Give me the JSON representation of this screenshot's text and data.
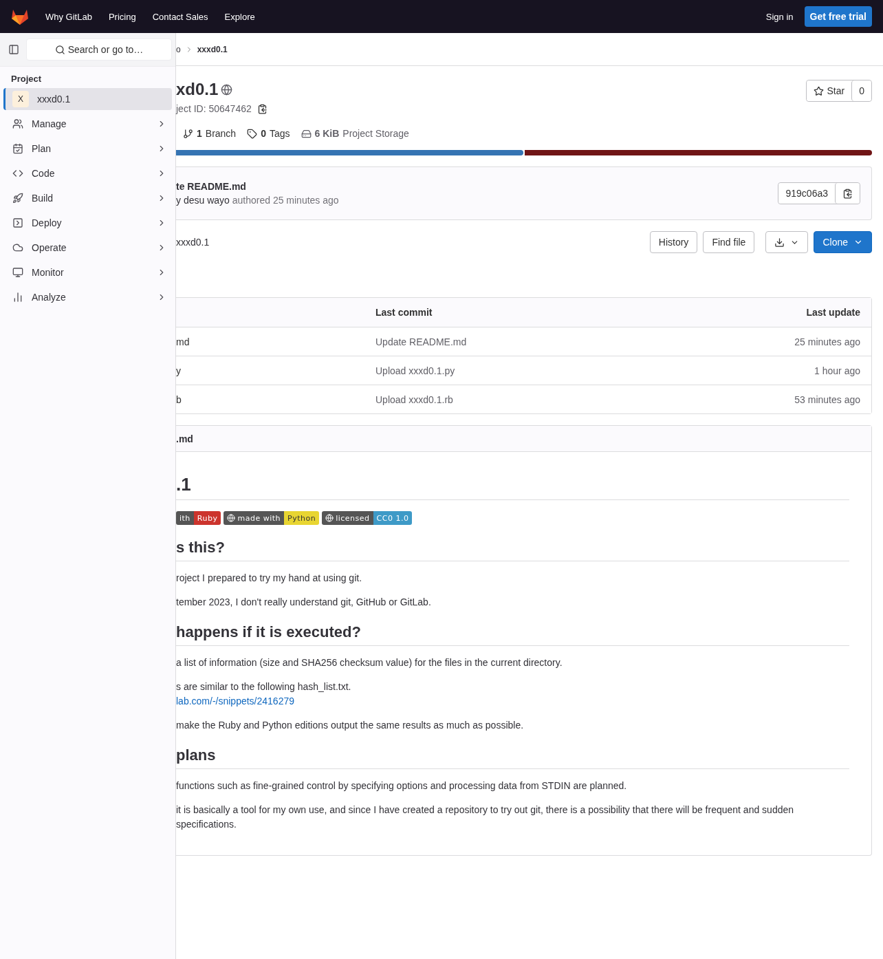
{
  "topnav": {
    "links": [
      "Why GitLab",
      "Pricing",
      "Contact Sales",
      "Explore"
    ],
    "sign_in": "Sign in",
    "trial": "Get free trial"
  },
  "sidebar": {
    "search_placeholder": "Search or go to…",
    "section": "Project",
    "items": [
      {
        "label": "xxxd0.1",
        "avatar": "X",
        "selected": true,
        "kind": "project"
      },
      {
        "label": "Manage",
        "selected": false,
        "kind": "menu"
      },
      {
        "label": "Plan",
        "selected": false,
        "kind": "menu"
      },
      {
        "label": "Code",
        "selected": false,
        "kind": "menu"
      },
      {
        "label": "Build",
        "selected": false,
        "kind": "menu"
      },
      {
        "label": "Deploy",
        "selected": false,
        "kind": "menu"
      },
      {
        "label": "Operate",
        "selected": false,
        "kind": "menu"
      },
      {
        "label": "Monitor",
        "selected": false,
        "kind": "menu"
      },
      {
        "label": "Analyze",
        "selected": false,
        "kind": "menu"
      }
    ]
  },
  "breadcrumb": [
    "o",
    "xxxd0.1"
  ],
  "project": {
    "title": "xd0.1",
    "id_text": "ject ID: 50647462",
    "star": "Star",
    "star_count": "0",
    "stats": [
      {
        "value": "1",
        "label": "Branch",
        "kind": "branch"
      },
      {
        "value": "0",
        "label": "Tags",
        "kind": "tag"
      },
      {
        "value": "6 KiB",
        "label": "Project Storage",
        "kind": "storage"
      }
    ]
  },
  "language_bar": [
    {
      "color": "#3574b3"
    },
    {
      "color": "#701516"
    }
  ],
  "commit": {
    "title": "te README.md",
    "author": "y desu wayo",
    "meta": "authored 25 minutes ago",
    "sha": "919c06a3"
  },
  "ref": "xxxd0.1",
  "actions": {
    "history": "History",
    "find_file": "Find file",
    "clone": "Clone"
  },
  "table": {
    "columns": [
      "Last commit",
      "Last update"
    ],
    "rows": [
      {
        "name": "md",
        "commit": "Update README.md",
        "updated": "25 minutes ago"
      },
      {
        "name": "y",
        "commit": "Upload xxxd0.1.py",
        "updated": "1 hour ago"
      },
      {
        "name": "b",
        "commit": "Upload xxxd0.1.rb",
        "updated": "53 minutes ago"
      }
    ]
  },
  "readme": {
    "filename": ".md",
    "blocks": [
      {
        "kind": "h1",
        "text": ".1"
      },
      {
        "kind": "badges",
        "items": [
          {
            "left": "ith",
            "right": "Ruby",
            "color": "#cc342d",
            "icon": false
          },
          {
            "left": "made with",
            "right": "Python",
            "color": "#e8d532",
            "icon": true
          },
          {
            "left": "licensed",
            "right": "CC0 1.0",
            "color": "#3e9ac7",
            "icon": true
          }
        ]
      },
      {
        "kind": "h2",
        "text": "s this?"
      },
      {
        "kind": "p",
        "lines": [
          "roject I prepared to try my hand at using git."
        ]
      },
      {
        "kind": "p",
        "lines": [
          "tember 2023, I don't really understand git, GitHub or GitLab."
        ]
      },
      {
        "kind": "h2",
        "text": "happens if it is executed?"
      },
      {
        "kind": "p",
        "lines": [
          "a list of information (size and SHA256 checksum value) for the files in the current directory."
        ]
      },
      {
        "kind": "p",
        "lines": [
          "s are similar to the following hash_list.txt."
        ],
        "link": "lab.com/-/snippets/2416279"
      },
      {
        "kind": "p",
        "lines": [
          "make the Ruby and Python editions output the same results as much as possible."
        ]
      },
      {
        "kind": "h2",
        "text": "plans"
      },
      {
        "kind": "p",
        "lines": [
          "functions such as fine-grained control by specifying options and processing data from STDIN are planned."
        ]
      },
      {
        "kind": "p",
        "lines": [
          "it is basically a tool for my own use, and since I have created a repository to try out git, there is a possibility that there will be frequent and sudden",
          "specifications."
        ]
      }
    ]
  }
}
